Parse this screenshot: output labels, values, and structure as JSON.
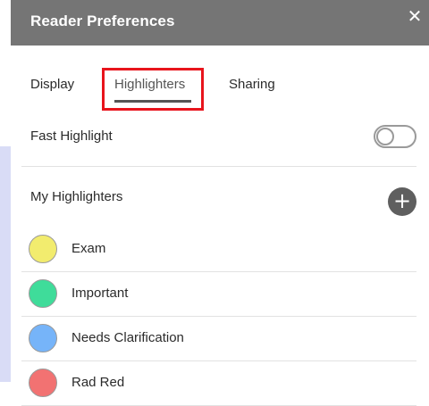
{
  "window": {
    "title": "Reader Preferences",
    "close_glyph": "✕"
  },
  "tabs": [
    {
      "label": "Display"
    },
    {
      "label": "Highlighters",
      "active": true
    },
    {
      "label": "Sharing"
    }
  ],
  "fast_highlight": {
    "label": "Fast Highlight",
    "enabled": false
  },
  "my_highlighters": {
    "label": "My Highlighters",
    "add_glyph": "+"
  },
  "highlighters": [
    {
      "name": "Exam",
      "color": "#f2ec6e"
    },
    {
      "name": "Important",
      "color": "#3fdc9a"
    },
    {
      "name": "Needs Clarification",
      "color": "#76b4f9"
    },
    {
      "name": "Rad Red",
      "color": "#f27272"
    }
  ],
  "colors": {
    "header_bg": "#757575",
    "annotation_box": "#e8141c",
    "left_strip": "#d9dcf6"
  }
}
